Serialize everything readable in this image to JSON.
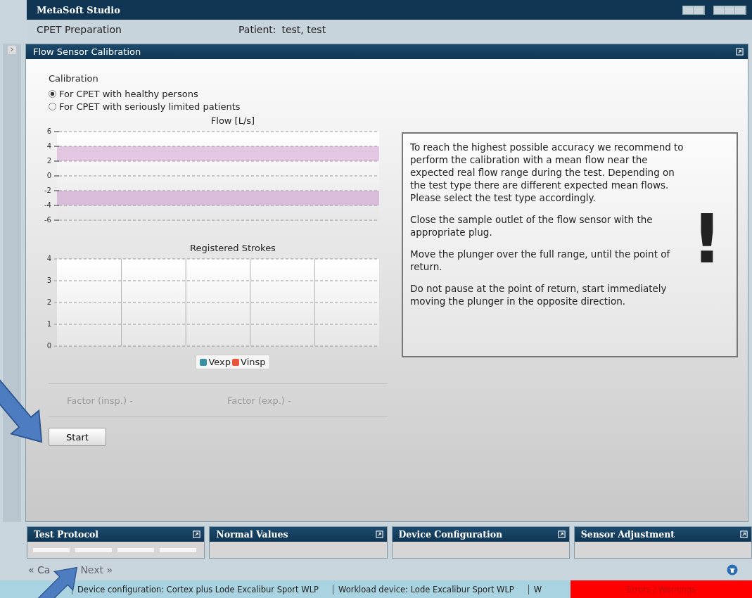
{
  "app_title": "MetaSoft Studio",
  "header": {
    "section": "CPET Preparation",
    "patient_label": "Patient:",
    "patient_name": "test, test"
  },
  "panel": {
    "title": "Flow Sensor Calibration",
    "calibration": {
      "label": "Calibration",
      "options": [
        {
          "label": "For CPET with healthy persons",
          "selected": true
        },
        {
          "label": "For CPET with seriously limited patients",
          "selected": false
        }
      ]
    },
    "flow_chart": {
      "chart_data": {
        "type": "line",
        "categories": [
          null
        ],
        "title": "Flow [L/s]",
        "ylim": [
          -6,
          6
        ],
        "yticks": [
          -6,
          -4,
          -2,
          0,
          2,
          4,
          6
        ],
        "grid": true,
        "bands": [
          {
            "axis": "y",
            "from": 2,
            "to": 4,
            "color": "#e2c6e2"
          },
          {
            "axis": "y",
            "from": -4,
            "to": -2,
            "color": "#d9bcd9"
          }
        ]
      }
    },
    "strokes_chart": {
      "chart_data": {
        "type": "bar",
        "title": "Registered Strokes",
        "categories": [
          null,
          null,
          null,
          null,
          null
        ],
        "ylim": [
          0,
          4
        ],
        "yticks": [
          0,
          1,
          2,
          3,
          4
        ],
        "grid": true,
        "series": [
          {
            "name": "Vexp",
            "color": "#3a8fa0",
            "values": [
              null,
              null,
              null,
              null,
              null
            ]
          },
          {
            "name": "Vinsp",
            "color": "#e8553a",
            "values": [
              null,
              null,
              null,
              null,
              null
            ]
          }
        ]
      }
    },
    "factors": [
      {
        "label": "Factor (insp.)",
        "value": "-"
      },
      {
        "label": "Factor (exp.)",
        "value": "-"
      }
    ],
    "start_button": "Start",
    "instructions": [
      "To reach the highest possible accuracy we recommend to perform the calibration with a mean flow near the expected real flow range during the test. Depending on the test type there are different expected mean flows. Please select the test type accordingly.",
      "Close the sample outlet of the flow sensor with the appropriate plug.",
      "Move the plunger over the full range, until the point of return.",
      "Do not pause at the point of return, start immediately moving the plunger in the opposite direction."
    ],
    "warning_mark": "!"
  },
  "bottom_panels": [
    {
      "title": "Test Protocol",
      "kind": "segments"
    },
    {
      "title": "Normal Values",
      "kind": "empty"
    },
    {
      "title": "Device Configuration",
      "kind": "empty"
    },
    {
      "title": "Sensor Adjustment",
      "kind": "empty"
    }
  ],
  "sidebar": {
    "expander": "›"
  },
  "navigation": {
    "back": "« Ca",
    "next": "Next »"
  },
  "status_bar": {
    "items": [
      "Device configuration: Cortex plus Lode Excalibur Sport WLP",
      "Workload device: Lode Excalibur Sport WLP",
      "W"
    ],
    "alert": "Errors / Warnings"
  }
}
